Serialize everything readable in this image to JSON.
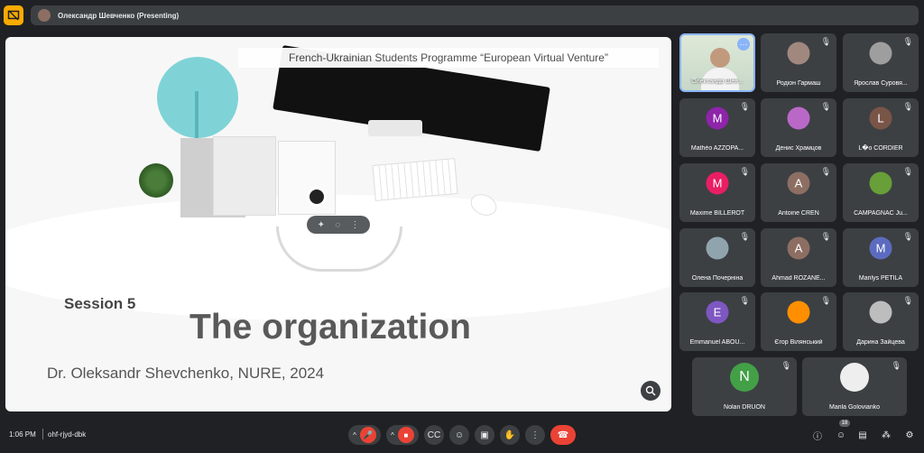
{
  "presenting": {
    "label": "Олександр Шевченко (Presenting)"
  },
  "slide": {
    "header": "French-Ukrainian Students Programme “European Virtual Venture”",
    "session": "Session 5",
    "title": "The organization",
    "author": "Dr. Oleksandr Shevchenko, NURE, 2024"
  },
  "participants": [
    {
      "name": "Олександр Шев...",
      "type": "video",
      "col": 0,
      "row": 0
    },
    {
      "name": "Родіон Гармаш",
      "type": "photo",
      "color": "#a1887f",
      "col": 1,
      "row": 0
    },
    {
      "name": "Ярослав Суровя...",
      "type": "photo",
      "color": "#9e9e9e",
      "col": 2,
      "row": 0
    },
    {
      "name": "Mathéo AZZOPA...",
      "initial": "M",
      "color": "#8e24aa",
      "col": 0,
      "row": 1
    },
    {
      "name": "Денис Храмцов",
      "type": "photo",
      "color": "#ba68c8",
      "col": 1,
      "row": 1
    },
    {
      "name": "L�o CORDIER",
      "initial": "L",
      "color": "#795548",
      "col": 2,
      "row": 1
    },
    {
      "name": "Maxime BILLEROT",
      "initial": "M",
      "color": "#e91e63",
      "col": 0,
      "row": 2
    },
    {
      "name": "Antoine CREN",
      "initial": "A",
      "color": "#8d6e63",
      "col": 1,
      "row": 2
    },
    {
      "name": "CAMPAGNAC Ju...",
      "type": "photo",
      "color": "#689f38",
      "col": 2,
      "row": 2
    },
    {
      "name": "Олена Почерніна",
      "type": "photo",
      "color": "#90a4ae",
      "col": 0,
      "row": 3
    },
    {
      "name": "Ahmad ROZANE...",
      "initial": "A",
      "color": "#8d6e63",
      "col": 1,
      "row": 3
    },
    {
      "name": "Marilys PETILA",
      "initial": "M",
      "color": "#5c6bc0",
      "col": 2,
      "row": 3
    },
    {
      "name": "Emmanuel ABOU...",
      "initial": "E",
      "color": "#7e57c2",
      "col": 0,
      "row": 4
    },
    {
      "name": "Єгор Вілянський",
      "type": "photo",
      "color": "#ff8f00",
      "col": 1,
      "row": 4
    },
    {
      "name": "Дарина Зайцева",
      "type": "photo",
      "color": "#bdbdbd",
      "col": 2,
      "row": 4
    }
  ],
  "bottom_participants": [
    {
      "name": "Nolan DRUON",
      "initial": "N",
      "color": "#43a047"
    },
    {
      "name": "Marila Golovianko",
      "type": "photo",
      "color": "#eeeeee"
    }
  ],
  "bottom_bar": {
    "time": "1:06 PM",
    "code": "ohf-rjyd-dbk",
    "participant_count": "18"
  },
  "icons": {
    "mic_off": "mic-off-icon",
    "camera_off": "camera-off-icon",
    "captions": "captions-icon",
    "emoji": "emoji-icon",
    "present": "present-icon",
    "raise_hand": "hand-icon",
    "more": "more-icon",
    "leave": "hangup-icon",
    "info": "info-icon",
    "people": "people-icon",
    "chat": "chat-icon",
    "activities": "activities-icon",
    "host_controls": "lock-icon"
  },
  "colors": {
    "presenting": "#f9ab00",
    "leave": "#ea4335",
    "active_border": "#8ab4f8"
  }
}
